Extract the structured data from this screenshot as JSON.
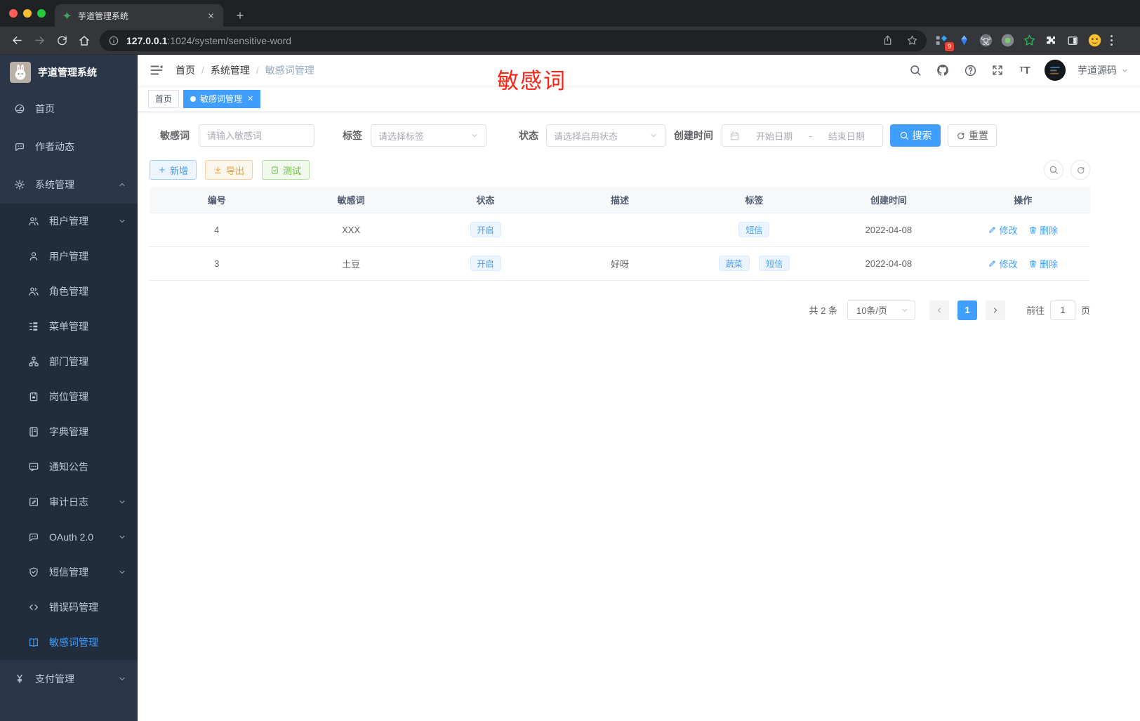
{
  "colors": {
    "primary": "#409eff",
    "annotation_red": "#fd2014",
    "warning": "#e6a23c",
    "success": "#67c23a",
    "sidebar_bg": "#2b3648",
    "sidebar_sub_bg": "#212c3d"
  },
  "browser": {
    "tab_title": "芋道管理系统",
    "url_host": "127.0.0.1",
    "url_rest": ":1024/system/sensitive-word",
    "extension_badge": "9"
  },
  "sidebar": {
    "logo_title": "芋道管理系统",
    "items": [
      {
        "label": "首页"
      },
      {
        "label": "作者动态"
      },
      {
        "label": "系统管理"
      },
      {
        "label": "租户管理"
      },
      {
        "label": "用户管理"
      },
      {
        "label": "角色管理"
      },
      {
        "label": "菜单管理"
      },
      {
        "label": "部门管理"
      },
      {
        "label": "岗位管理"
      },
      {
        "label": "字典管理"
      },
      {
        "label": "通知公告"
      },
      {
        "label": "审计日志"
      },
      {
        "label": "OAuth 2.0"
      },
      {
        "label": "短信管理"
      },
      {
        "label": "错误码管理"
      },
      {
        "label": "敏感词管理"
      },
      {
        "label": "支付管理"
      }
    ]
  },
  "header": {
    "breadcrumb": {
      "home": "首页",
      "section": "系统管理",
      "current": "敏感词管理"
    },
    "username": "芋道源码"
  },
  "annotation": {
    "text": "敏感词"
  },
  "tags": {
    "home": "首页",
    "current": "敏感词管理"
  },
  "filters": {
    "keyword_label": "敏感词",
    "keyword_placeholder": "请输入敏感词",
    "tag_label": "标签",
    "tag_placeholder": "请选择标签",
    "status_label": "状态",
    "status_placeholder": "请选择启用状态",
    "date_label": "创建时间",
    "date_start_placeholder": "开始日期",
    "date_separator": "-",
    "date_end_placeholder": "结束日期",
    "search_label": "搜索",
    "reset_label": "重置"
  },
  "toolbar": {
    "add_label": "新增",
    "export_label": "导出",
    "test_label": "测试"
  },
  "table": {
    "headers": {
      "id": "编号",
      "word": "敏感词",
      "status": "状态",
      "desc": "描述",
      "tags": "标签",
      "created": "创建时间",
      "actions": "操作"
    },
    "rows": [
      {
        "id": "4",
        "word": "XXX",
        "status": "开启",
        "desc": "",
        "tags": [
          "短信"
        ],
        "created": "2022-04-08"
      },
      {
        "id": "3",
        "word": "土豆",
        "status": "开启",
        "desc": "好呀",
        "tags": [
          "蔬菜",
          "短信"
        ],
        "created": "2022-04-08"
      }
    ],
    "edit_label": "修改",
    "delete_label": "删除"
  },
  "pagination": {
    "total": "共 2 条",
    "page_size": "10条/页",
    "current_page": "1",
    "goto_label": "前往",
    "goto_value": "1",
    "page_unit": "页"
  }
}
